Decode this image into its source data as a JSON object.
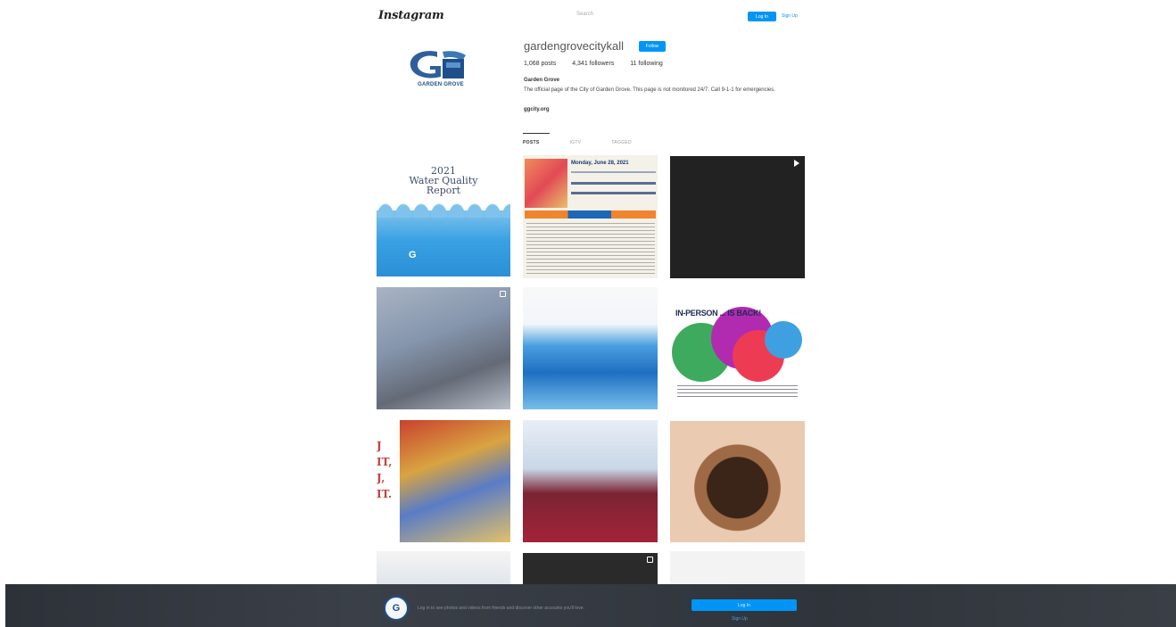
{
  "nav": {
    "logo": "Instagram",
    "search_placeholder": "Search",
    "login_label": "Log In",
    "signup_label": "Sign Up"
  },
  "profile": {
    "avatar_caption": "GARDEN GROVE",
    "avatar_letter": "G",
    "username": "gardengrovecitykall",
    "follow_label": "Follow",
    "stats": {
      "posts": "1,068 posts",
      "followers": "4,341 followers",
      "following": "11 following"
    },
    "bio_name": "Garden Grove",
    "bio_text": "The official page of the City of Garden Grove. This page is not monitored 24/7. Call 9-1-1 for emergencies.",
    "bio_link": "ggcity.org"
  },
  "tabs": {
    "posts": "POSTS",
    "igtv": "IGTV",
    "tagged": "TAGGED"
  },
  "posts": {
    "t1_year": "2021",
    "t1_title": "Water Quality",
    "t1_subtitle": "Report",
    "t2_heading": "Monday, June 28, 2021",
    "t6_heading": "IN-PERSON ... IS BACK!",
    "t7_side": "J\nIT,\nJ,\nIT."
  },
  "banner": {
    "text": "Log in to see photos and videos from friends and discover other accounts you'll love.",
    "button_label": "Log In",
    "link_label": "Sign Up"
  }
}
